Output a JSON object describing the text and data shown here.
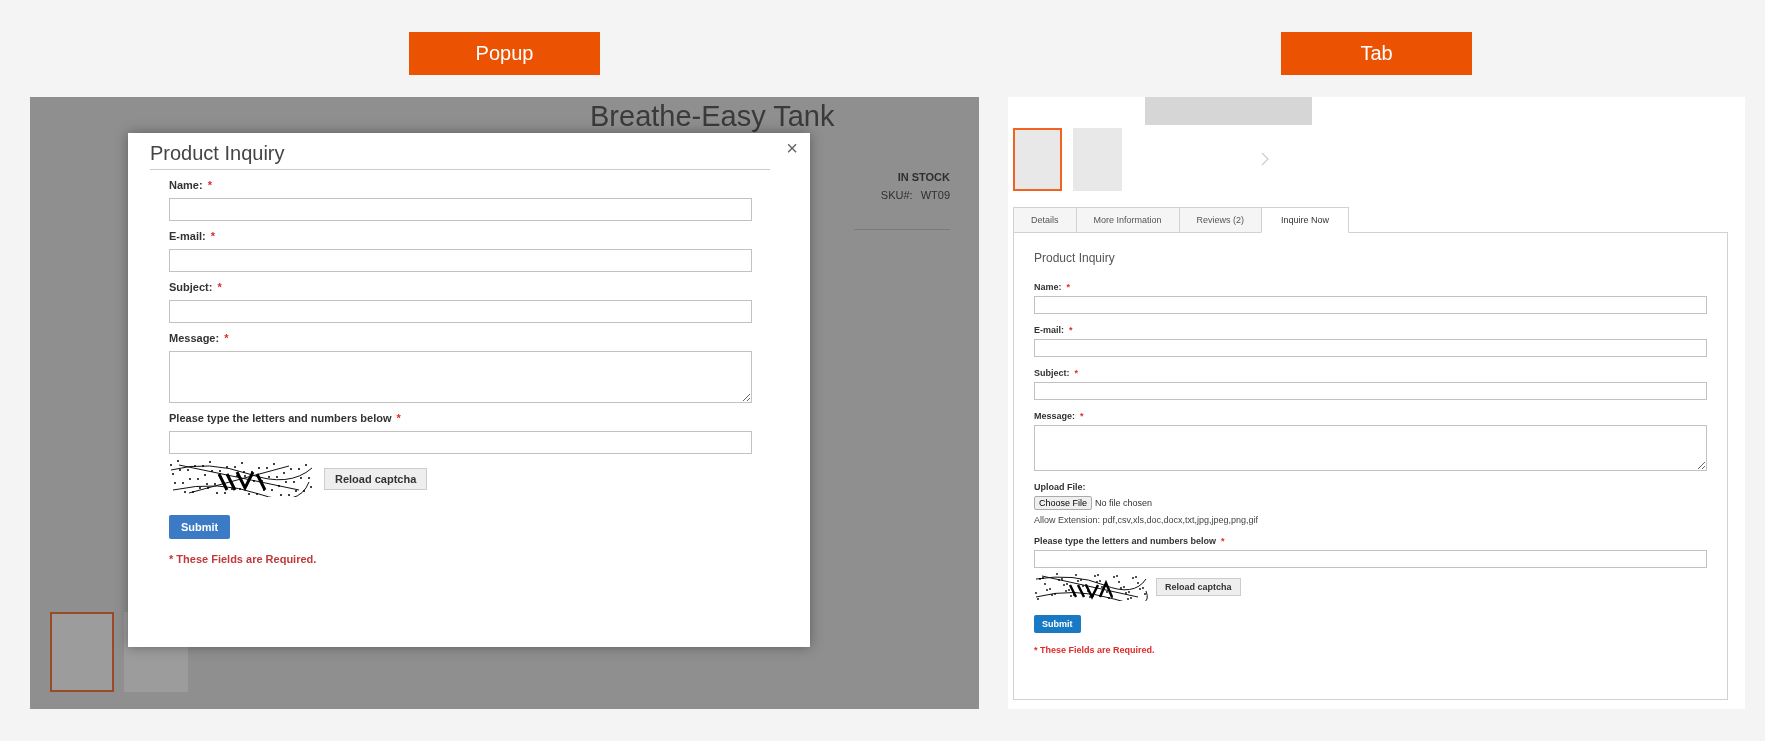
{
  "popup_demo": {
    "label": "Popup",
    "product_title": "Breathe-Easy Tank",
    "stock": "IN STOCK",
    "sku_label": "SKU#:",
    "sku": "WT09",
    "thumbnails": [
      {
        "selected": true
      },
      {
        "selected": false
      }
    ],
    "modal": {
      "title": "Product Inquiry",
      "close": "×",
      "fields": [
        {
          "kind": "input",
          "label": "Name:",
          "mark": "*"
        },
        {
          "kind": "input",
          "label": "E-mail:",
          "mark": "*"
        },
        {
          "kind": "input",
          "label": "Subject:",
          "mark": "*"
        },
        {
          "kind": "textarea",
          "label": "Message:",
          "mark": "*"
        },
        {
          "kind": "input",
          "label": "Please type the letters and numbers below",
          "mark": "*"
        }
      ],
      "reload": "Reload captcha",
      "submit": "Submit",
      "required_note": "* These Fields are Required."
    }
  },
  "tab_demo": {
    "label": "Tab",
    "thumbnails": [
      {
        "selected": true
      },
      {
        "selected": false
      }
    ],
    "tabs": [
      {
        "label": "Details",
        "selected": false
      },
      {
        "label": "More Information",
        "selected": false
      },
      {
        "label": "Reviews (2)",
        "selected": false
      },
      {
        "label": "Inquire Now",
        "selected": true
      }
    ],
    "heading": "Product Inquiry",
    "fields": [
      {
        "kind": "input",
        "label": "Name:",
        "mark": "*"
      },
      {
        "kind": "input",
        "label": "E-mail:",
        "mark": "*"
      },
      {
        "kind": "input",
        "label": "Subject:",
        "mark": "*"
      },
      {
        "kind": "textarea",
        "label": "Message:",
        "mark": "*"
      },
      {
        "kind": "file",
        "label": "Upload File:",
        "button": "Choose File",
        "status": "No file chosen",
        "hint": "Allow Extension: pdf,csv,xls,doc,docx,txt,jpg,jpeg,png,gif"
      },
      {
        "kind": "input",
        "label": "Please type the letters and numbers below",
        "mark": "*"
      }
    ],
    "reload": "Reload captcha",
    "submit": "Submit",
    "required_note": "* These Fields are Required."
  }
}
